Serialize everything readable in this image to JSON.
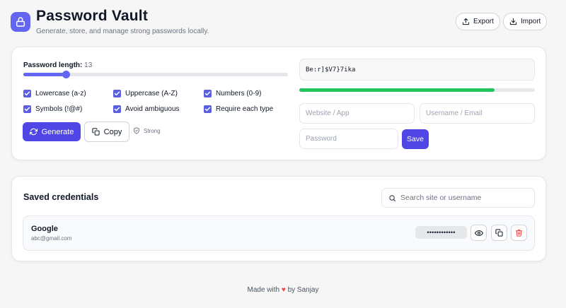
{
  "header": {
    "title": "Password Vault",
    "subtitle": "Generate, store, and manage strong passwords locally.",
    "export_label": "Export",
    "import_label": "Import",
    "icons": {
      "logo": "lock-icon",
      "export": "upload-icon",
      "import": "download-icon"
    }
  },
  "generator": {
    "length_label": "Password length:",
    "length_value": "13",
    "length_fraction": 0.16,
    "options": [
      {
        "label": "Lowercase (a-z)",
        "checked": true
      },
      {
        "label": "Uppercase (A-Z)",
        "checked": true
      },
      {
        "label": "Numbers (0-9)",
        "checked": true
      },
      {
        "label": "Symbols (!@#)",
        "checked": true
      },
      {
        "label": "Avoid ambiguous",
        "checked": true
      },
      {
        "label": "Require each type",
        "checked": true
      }
    ],
    "generate_label": "Generate",
    "copy_label": "Copy",
    "strength_label": "Strong",
    "generated_password": "Be:r]$V7}7ika",
    "strength_fraction": 0.83
  },
  "save_form": {
    "website_placeholder": "Website / App",
    "username_placeholder": "Username / Email",
    "password_placeholder": "Password",
    "save_label": "Save"
  },
  "saved": {
    "title": "Saved credentials",
    "search_placeholder": "Search site or username",
    "items": [
      {
        "site": "Google",
        "username": "abc@gmail.com",
        "masked": "••••••••••••"
      }
    ]
  },
  "footer": {
    "prefix": "Made with",
    "suffix": "by Sanjay"
  },
  "colors": {
    "accent": "#4f46e5",
    "slider": "#6366f1",
    "strength": "#22c55e",
    "danger": "#ef4444"
  }
}
